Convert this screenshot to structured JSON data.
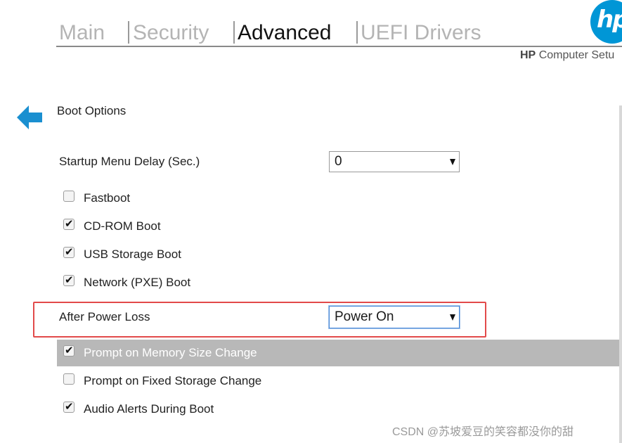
{
  "tabs": [
    {
      "label": "Main",
      "active": false
    },
    {
      "label": "Security",
      "active": false
    },
    {
      "label": "Advanced",
      "active": true
    },
    {
      "label": "UEFI Drivers",
      "active": false
    }
  ],
  "logo": {
    "text": "hp",
    "color": "#0096d6"
  },
  "header": {
    "brand": "HP",
    "subtitle": "Computer Setu"
  },
  "section": {
    "title": "Boot Options",
    "back_icon": "back-arrow-icon"
  },
  "startup_delay": {
    "label": "Startup Menu Delay (Sec.)",
    "value": "0"
  },
  "options": [
    {
      "label": "Fastboot",
      "checked": false
    },
    {
      "label": "CD-ROM Boot",
      "checked": true
    },
    {
      "label": "USB Storage Boot",
      "checked": true
    },
    {
      "label": "Network (PXE) Boot",
      "checked": true
    }
  ],
  "after_power_loss": {
    "label": "After Power Loss",
    "value": "Power On"
  },
  "options2": [
    {
      "label": "Prompt on Memory Size Change",
      "checked": true,
      "highlighted": true
    },
    {
      "label": "Prompt on Fixed Storage Change",
      "checked": false,
      "highlighted": false
    },
    {
      "label": "Audio Alerts During Boot",
      "checked": true,
      "highlighted": false
    }
  ],
  "check_glyph": "✔",
  "watermark": "CSDN @苏坡爱豆的笑容都没你的甜",
  "colors": {
    "accent": "#0096d6",
    "highlight_row": "#b8b8b8",
    "annotation": "#e24a4a"
  }
}
